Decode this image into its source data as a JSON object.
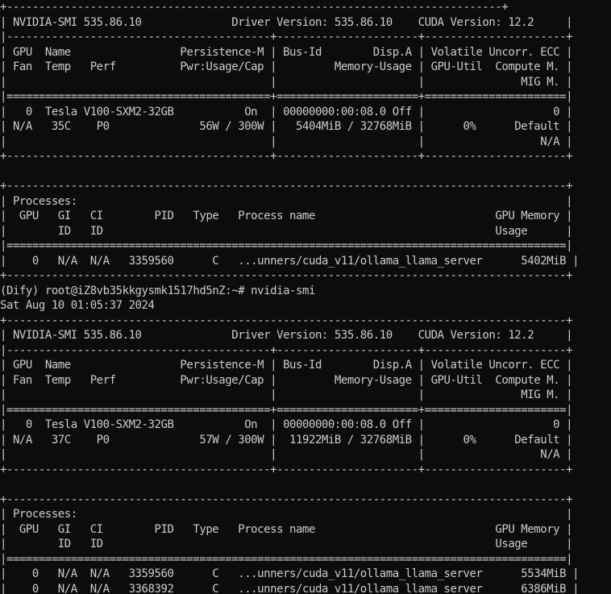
{
  "terminal": {
    "lines": [
      "+-----------------------------------------------------------------------------+",
      "| NVIDIA-SMI 535.86.10              Driver Version: 535.86.10    CUDA Version: 12.2     |",
      "|-----------------------------------------+----------------------+----------------------+",
      "| GPU  Name                 Persistence-M | Bus-Id        Disp.A | Volatile Uncorr. ECC |",
      "| Fan  Temp   Perf          Pwr:Usage/Cap |         Memory-Usage | GPU-Util  Compute M. |",
      "|                                         |                      |               MIG M. |",
      "|=========================================+======================+======================|",
      "|   0  Tesla V100-SXM2-32GB           On  | 00000000:00:08.0 Off |                    0 |",
      "| N/A   35C    P0              56W / 300W |   5404MiB / 32768MiB |      0%      Default |",
      "|                                         |                      |                  N/A |",
      "+-----------------------------------------+----------------------+----------------------+",
      "",
      "+---------------------------------------------------------------------------------------+",
      "| Processes:                                                                            |",
      "|  GPU   GI   CI        PID   Type   Process name                            GPU Memory |",
      "|        ID   ID                                                             Usage      |",
      "|=======================================================================================|",
      "|    0   N/A  N/A   3359560      C   ...unners/cuda_v11/ollama_llama_server      5402MiB |",
      "+---------------------------------------------------------------------------------------+",
      "(Dify) root@iZ8vb35kkgysmk1517hd5nZ:~# nvidia-smi",
      "Sat Aug 10 01:05:37 2024",
      "+---------------------------------------------------------------------------------------+",
      "| NVIDIA-SMI 535.86.10              Driver Version: 535.86.10    CUDA Version: 12.2     |",
      "|-----------------------------------------+----------------------+----------------------+",
      "| GPU  Name                 Persistence-M | Bus-Id        Disp.A | Volatile Uncorr. ECC |",
      "| Fan  Temp   Perf          Pwr:Usage/Cap |         Memory-Usage | GPU-Util  Compute M. |",
      "|                                         |                      |               MIG M. |",
      "|=========================================+======================+======================|",
      "|   0  Tesla V100-SXM2-32GB           On  | 00000000:00:08.0 Off |                    0 |",
      "| N/A   37C    P0              57W / 300W |  11922MiB / 32768MiB |      0%      Default |",
      "|                                         |                      |                  N/A |",
      "+-----------------------------------------+----------------------+----------------------+",
      "",
      "+---------------------------------------------------------------------------------------+",
      "| Processes:                                                                            |",
      "|  GPU   GI   CI        PID   Type   Process name                            GPU Memory |",
      "|        ID   ID                                                             Usage      |",
      "|=======================================================================================|",
      "|    0   N/A  N/A   3359560      C   ...unners/cuda_v11/ollama_llama_server      5534MiB |",
      "|    0   N/A  N/A   3368392      C   ...unners/cuda_v11/ollama_llama_server      6386MiB |",
      "+---------------------------------------------------------------------------------------+"
    ]
  },
  "colors": {
    "background": "#0c0c0c",
    "foreground": "#cccccc"
  }
}
